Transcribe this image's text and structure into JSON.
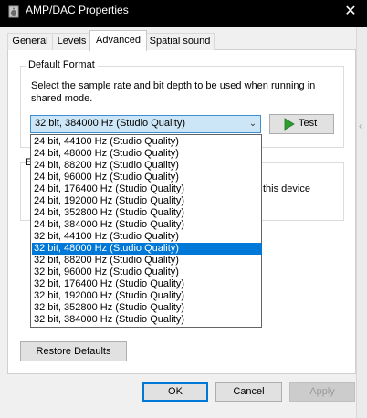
{
  "window": {
    "title": "AMP/DAC Properties",
    "close_glyph": "✕"
  },
  "tabs": [
    {
      "label": "General",
      "active": false
    },
    {
      "label": "Levels",
      "active": false
    },
    {
      "label": "Advanced",
      "active": true
    },
    {
      "label": "Spatial sound",
      "active": false
    }
  ],
  "default_format": {
    "legend": "Default Format",
    "description": "Select the sample rate and bit depth to be used when running in shared mode.",
    "combo_value": "32 bit, 384000 Hz (Studio Quality)",
    "combo_arrow_glyph": "⌄",
    "test_label": "Test"
  },
  "dropdown": {
    "selected_index": 9,
    "options": [
      "24 bit, 44100 Hz (Studio Quality)",
      "24 bit, 48000 Hz (Studio Quality)",
      "24 bit, 88200 Hz (Studio Quality)",
      "24 bit, 96000 Hz (Studio Quality)",
      "24 bit, 176400 Hz (Studio Quality)",
      "24 bit, 192000 Hz (Studio Quality)",
      "24 bit, 352800 Hz (Studio Quality)",
      "24 bit, 384000 Hz (Studio Quality)",
      "32 bit, 44100 Hz (Studio Quality)",
      "32 bit, 48000 Hz (Studio Quality)",
      "32 bit, 88200 Hz (Studio Quality)",
      "32 bit, 96000 Hz (Studio Quality)",
      "32 bit, 176400 Hz (Studio Quality)",
      "32 bit, 192000 Hz (Studio Quality)",
      "32 bit, 352800 Hz (Studio Quality)",
      "32 bit, 384000 Hz (Studio Quality)"
    ]
  },
  "exclusive_mode": {
    "legend_fragment": "E",
    "visible_text": "this device"
  },
  "buttons": {
    "restore_defaults": "Restore Defaults",
    "ok": "OK",
    "cancel": "Cancel",
    "apply": "Apply"
  },
  "colors": {
    "accent": "#0078d7",
    "selection_bg": "#0078d7",
    "combo_bg": "#cde6f7",
    "play_icon": "#2e9c2e"
  },
  "icons": {
    "app": "speaker-icon",
    "test": "play-triangle-icon",
    "close": "close-icon",
    "combo": "chevron-down-icon"
  }
}
